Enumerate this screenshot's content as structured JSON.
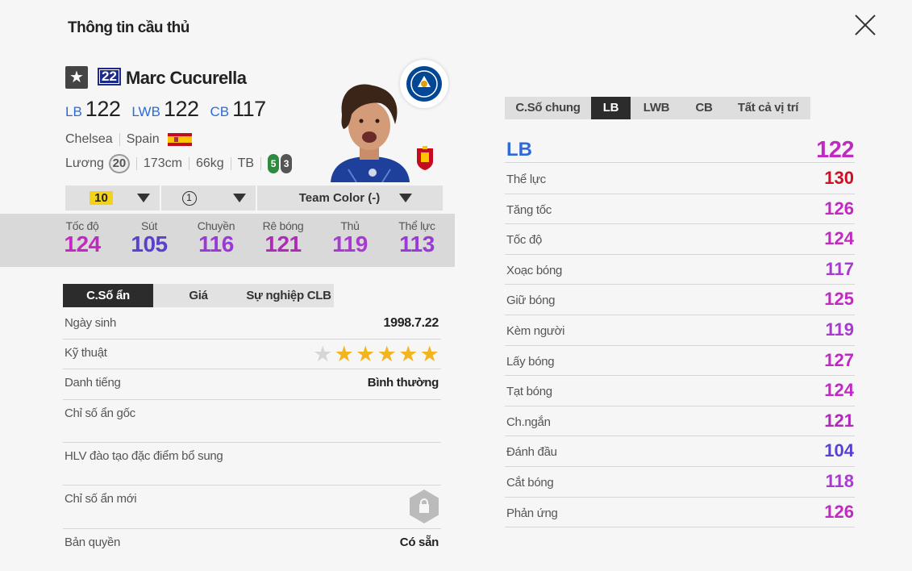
{
  "page": {
    "title": "Thông tin cầu thủ"
  },
  "player": {
    "name": "Marc Cucurella",
    "number": "22",
    "star": "★",
    "positions": [
      {
        "pos": "LB",
        "ovr": "122"
      },
      {
        "pos": "LWB",
        "ovr": "122"
      },
      {
        "pos": "CB",
        "ovr": "117"
      }
    ],
    "club": "Chelsea",
    "nation": "Spain",
    "salary_label": "Lương",
    "salary": "20",
    "height": "173cm",
    "weight": "66kg",
    "body_type": "TB",
    "left_foot": "5",
    "right_foot": "3"
  },
  "dropdowns": {
    "upgrade": "10",
    "level": "1",
    "team_color": "Team Color (-)"
  },
  "main_stats": [
    {
      "label": "Tốc độ",
      "value": "124",
      "color": "#c02ac0"
    },
    {
      "label": "Sút",
      "value": "105",
      "color": "#5a3fd0"
    },
    {
      "label": "Chuyền",
      "value": "116",
      "color": "#9a3ad6"
    },
    {
      "label": "Rê bóng",
      "value": "121",
      "color": "#b02ab8"
    },
    {
      "label": "Thủ",
      "value": "119",
      "color": "#a83ad2"
    },
    {
      "label": "Thể lực",
      "value": "113",
      "color": "#9a3ad6"
    }
  ],
  "left_tabs": [
    "C.Số ẩn",
    "Giá",
    "Sự nghiệp CLB"
  ],
  "info": {
    "birth_label": "Ngày sinh",
    "birth": "1998.7.22",
    "skill_label": "Kỹ thuật",
    "skill_stars": 5,
    "fame_label": "Danh tiếng",
    "fame": "Bình thường",
    "hidden_label": "Chỉ số ẩn gốc",
    "coach_label": "HLV đào tạo đặc điểm bổ sung",
    "new_hidden_label": "Chỉ số ẩn mới",
    "license_label": "Bản quyền",
    "license": "Có sẵn"
  },
  "right_tabs": [
    "C.Số chung",
    "LB",
    "LWB",
    "CB",
    "Tất cả vị trí"
  ],
  "position_detail": {
    "pos": "LB",
    "ovr": "122"
  },
  "attributes": [
    {
      "label": "Thể lực",
      "value": "130",
      "color": "#cc1122"
    },
    {
      "label": "Tăng tốc",
      "value": "126",
      "color": "#c02ac0"
    },
    {
      "label": "Tốc độ",
      "value": "124",
      "color": "#c02ac0"
    },
    {
      "label": "Xoạc bóng",
      "value": "117",
      "color": "#a83ad2"
    },
    {
      "label": "Giữ bóng",
      "value": "125",
      "color": "#c02ac0"
    },
    {
      "label": "Kèm người",
      "value": "119",
      "color": "#a83ad2"
    },
    {
      "label": "Lấy bóng",
      "value": "127",
      "color": "#c02ac0"
    },
    {
      "label": "Tạt bóng",
      "value": "124",
      "color": "#c02ac0"
    },
    {
      "label": "Ch.ngắn",
      "value": "121",
      "color": "#b02ab8"
    },
    {
      "label": "Đánh đầu",
      "value": "104",
      "color": "#5a3fd0"
    },
    {
      "label": "Cắt bóng",
      "value": "118",
      "color": "#a83ad2"
    },
    {
      "label": "Phản ứng",
      "value": "126",
      "color": "#c02ac0"
    }
  ]
}
